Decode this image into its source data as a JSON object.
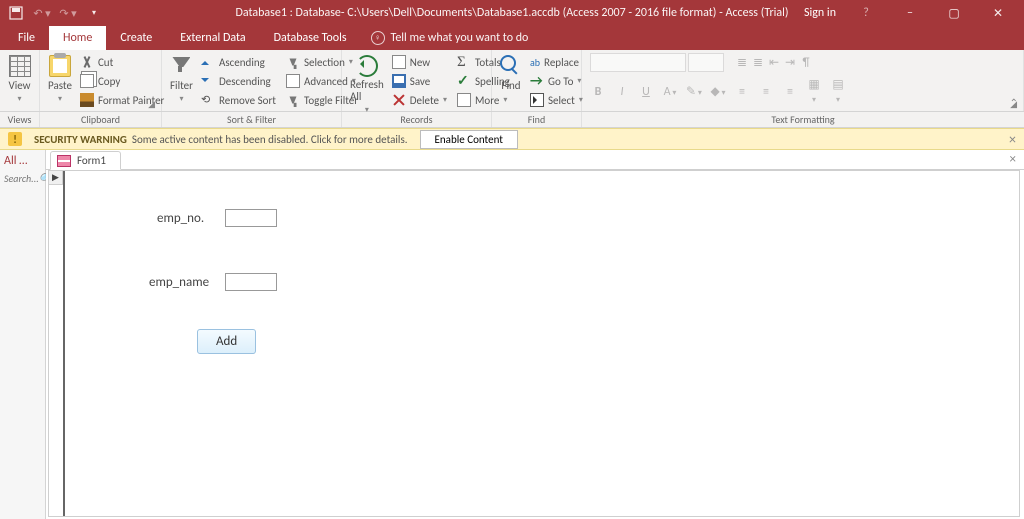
{
  "titlebar": {
    "title": "Database1 : Database- C:\\Users\\Dell\\Documents\\Database1.accdb (Access 2007 - 2016 file format) - Access (Trial)",
    "signin": "Sign in"
  },
  "tabs": {
    "file": "File",
    "home": "Home",
    "create": "Create",
    "external": "External Data",
    "dbtools": "Database Tools",
    "tellme": "Tell me what you want to do"
  },
  "ribbon": {
    "views": {
      "label": "Views",
      "view": "View"
    },
    "clipboard": {
      "label": "Clipboard",
      "paste": "Paste",
      "cut": "Cut",
      "copy": "Copy",
      "fmt": "Format Painter"
    },
    "sortfilter": {
      "label": "Sort & Filter",
      "filter": "Filter",
      "asc": "Ascending",
      "desc": "Descending",
      "remove": "Remove Sort",
      "selection": "Selection",
      "advanced": "Advanced",
      "toggle": "Toggle Filter"
    },
    "records": {
      "label": "Records",
      "refresh": "Refresh All",
      "new": "New",
      "save": "Save",
      "delete": "Delete",
      "totals": "Totals",
      "spelling": "Spelling",
      "more": "More"
    },
    "find": {
      "label": "Find",
      "find": "Find",
      "replace": "Replace",
      "goto": "Go To",
      "select": "Select"
    },
    "textfmt": {
      "label": "Text Formatting"
    }
  },
  "security": {
    "heading": "SECURITY WARNING",
    "msg": "Some active content has been disabled. Click for more details.",
    "button": "Enable Content"
  },
  "navpane": {
    "header": "All …",
    "search": "Search..."
  },
  "doc": {
    "tab": "Form1"
  },
  "form": {
    "label_emp_no": "emp_no.",
    "label_emp_name": "emp_name",
    "value_emp_no": "",
    "value_emp_name": "",
    "add_button": "Add"
  }
}
